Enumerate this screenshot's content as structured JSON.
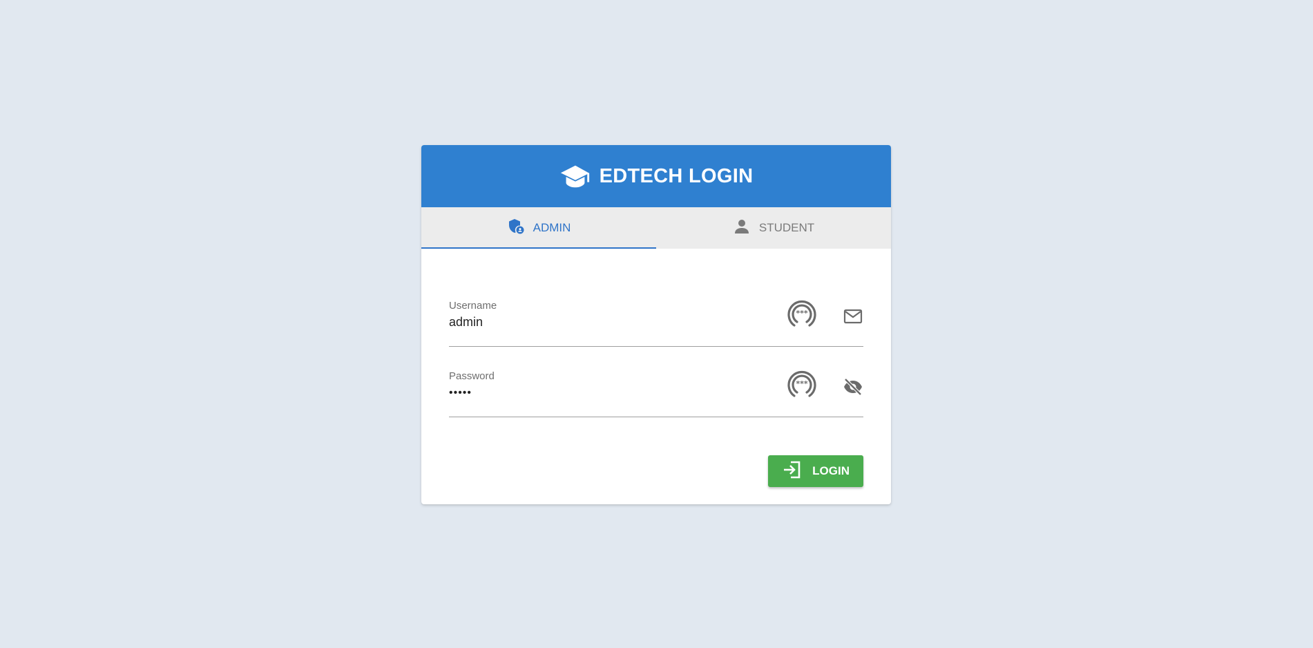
{
  "page": {
    "background_color": "#e1e8f0"
  },
  "header": {
    "title": "EDTECH LOGIN",
    "icon": "graduation-cap-icon",
    "color": "#2f80d0"
  },
  "tabs": [
    {
      "label": "ADMIN",
      "icon": "admin-shield-icon",
      "active": true
    },
    {
      "label": "STUDENT",
      "icon": "person-icon",
      "active": false
    }
  ],
  "form": {
    "username": {
      "label": "Username",
      "value": "admin",
      "badge_icon": "password-manager-key-icon",
      "trailing_icon": "mail-icon"
    },
    "password": {
      "label": "Password",
      "value": "•••••",
      "badge_icon": "password-manager-key-icon",
      "trailing_icon": "visibility-off-icon"
    }
  },
  "actions": {
    "login_label": "LOGIN",
    "login_icon": "login-icon",
    "login_color": "#4aad4e"
  },
  "accent_color": "#2f74c8"
}
